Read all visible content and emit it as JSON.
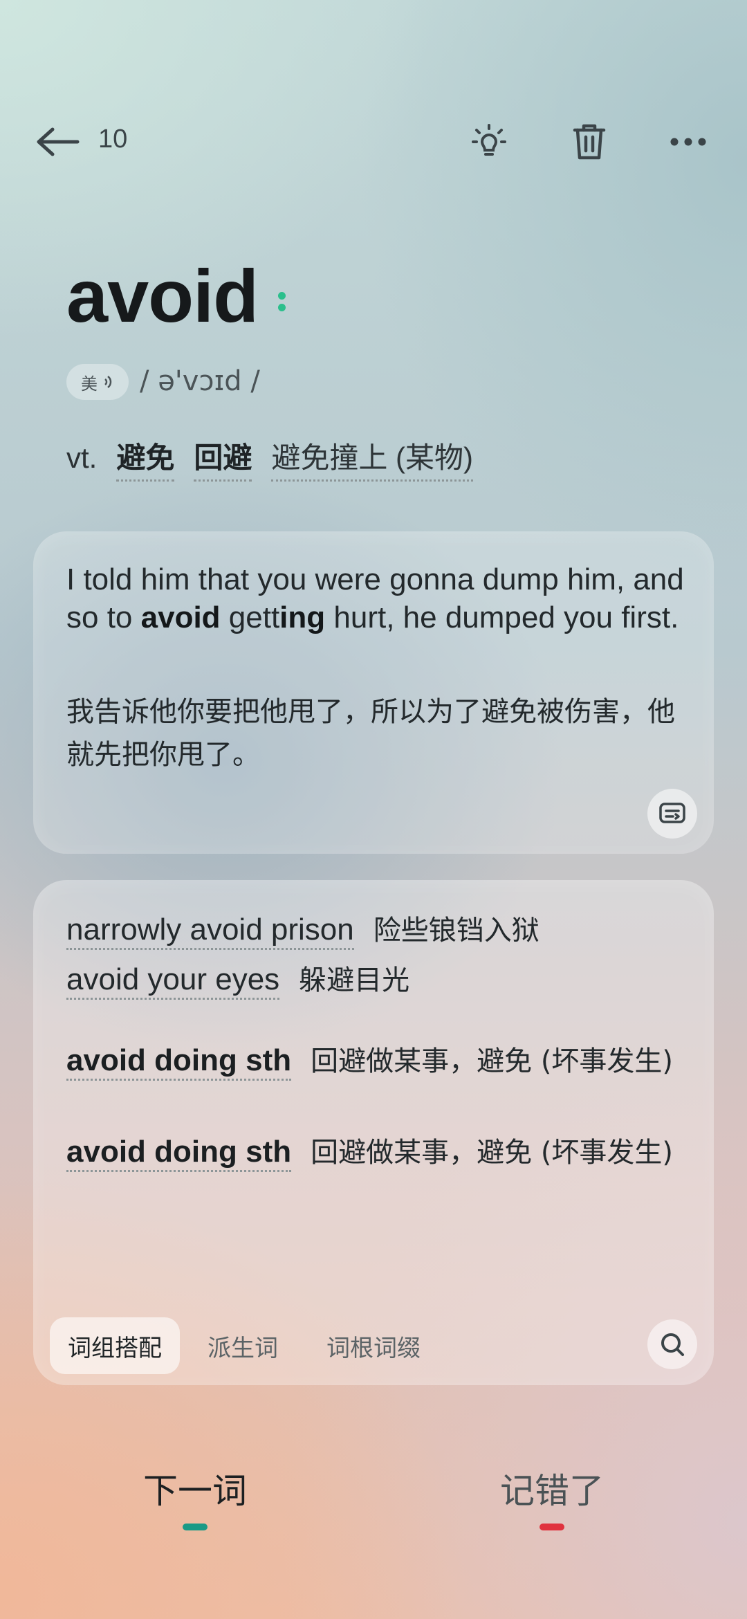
{
  "header": {
    "back_icon": "arrow-left-icon",
    "count": "10",
    "hint_icon": "lightbulb-icon",
    "delete_icon": "trash-icon",
    "more_icon": "more-horizontal-icon"
  },
  "word": {
    "text": "avoid",
    "accent": "美",
    "phonetic": "/ ə'vɔɪd /",
    "pos": "vt.",
    "definitions": [
      "避免",
      "回避",
      "避免撞上 (某物)"
    ]
  },
  "example": {
    "en_prefix": "I told him that you were gonna dump him, and so to ",
    "en_highlight": "avoid",
    "en_mid": " gett",
    "en_highlight2": "ing",
    "en_suffix": " hurt, he dumped you first.",
    "zh": "我告诉他你要把他甩了，所以为了避免被伤害，他就先把你甩了。"
  },
  "phrases": [
    {
      "en": "narrowly avoid prison",
      "zh": "险些锒铛入狱"
    },
    {
      "en": "avoid your eyes",
      "zh": "躲避目光"
    },
    {
      "en": "avoid doing sth",
      "zh": "回避做某事，避免 (坏事发生)"
    },
    {
      "en": "avoid doing sth",
      "zh": "回避做某事，避免 (坏事发生)"
    }
  ],
  "tabs": [
    "词组搭配",
    "派生词",
    "词根词缀"
  ],
  "actions": {
    "next": "下一词",
    "wrong": "记错了"
  },
  "colors": {
    "accent_green": "#2bbf8c",
    "next_indicator": "#1a9a86",
    "wrong_indicator": "#e0323e"
  }
}
